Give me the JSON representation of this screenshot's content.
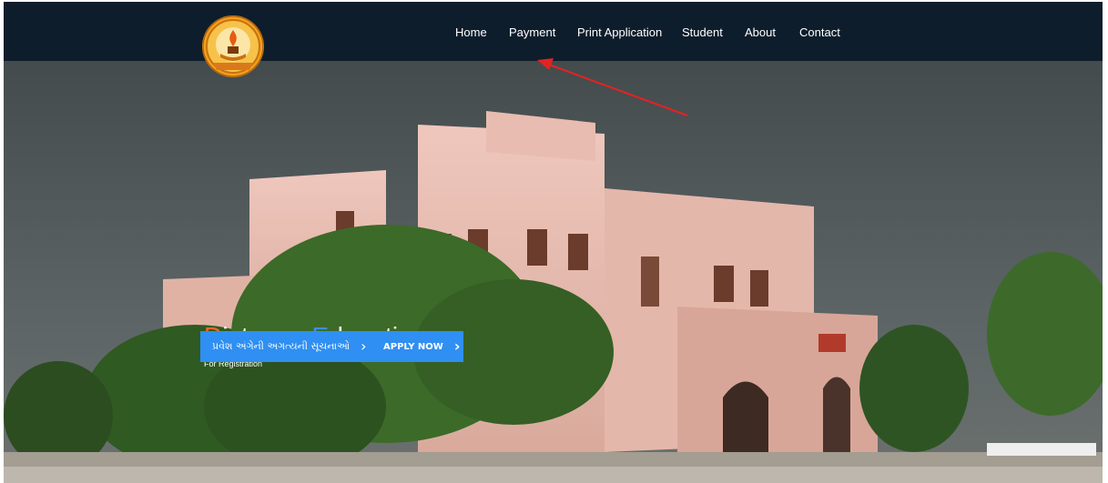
{
  "nav": {
    "items": [
      {
        "label": "Home"
      },
      {
        "label": "Payment"
      },
      {
        "label": "Print Application"
      },
      {
        "label": "Student"
      },
      {
        "label": "About"
      },
      {
        "label": "Contact"
      }
    ]
  },
  "hero": {
    "title_first_letter": "D",
    "title_rest_1": "istance ",
    "title_second_letter": "E",
    "title_rest_2": "ducation",
    "subtitle": "For Registration"
  },
  "buttons": {
    "notice_label": "પ્રવેશ અંગેની અગત્યની સૂચનાઓ",
    "apply_label": "APPLY NOW"
  },
  "colors": {
    "navbar": "#0e1d2c",
    "accent_blue": "#2f8ff2",
    "title_d": "#ef6a2a",
    "title_e": "#3b8fe6",
    "annotation_arrow": "#e52222"
  },
  "icons": {
    "logo": "university-logo-icon",
    "chevron": "chevron-right-icon"
  }
}
